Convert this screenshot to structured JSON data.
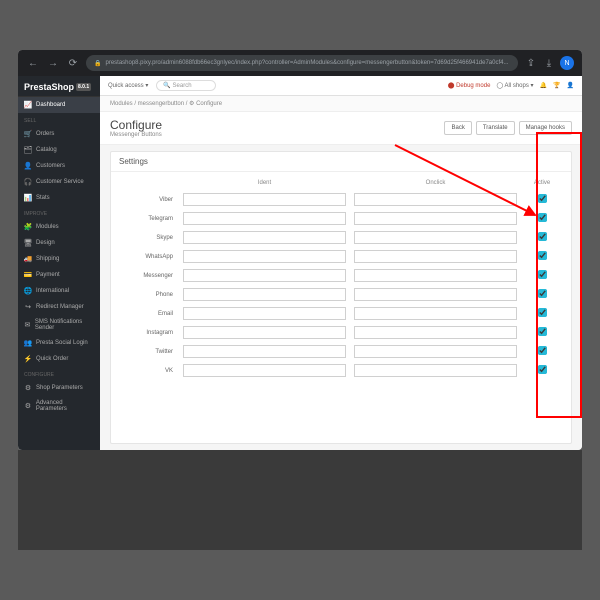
{
  "browser": {
    "url": "prestashop8.pixy.pro/admin6088fdb66ec3gnlyec/index.php?controller=AdminModules&configure=messengerbutton&token=7d69d25f466941de7a0cf4..."
  },
  "logo": {
    "text": "PrestaShop",
    "version": "8.0.1"
  },
  "topbar": {
    "quick": "Quick access",
    "search_ph": "Search",
    "debug": "Debug mode",
    "shops": "All shops"
  },
  "sidebar": {
    "dashboard": "Dashboard",
    "sect_sell": "SELL",
    "orders": "Orders",
    "catalog": "Catalog",
    "customers": "Customers",
    "customer_service": "Customer Service",
    "stats": "Stats",
    "sect_improve": "IMPROVE",
    "modules": "Modules",
    "design": "Design",
    "shipping": "Shipping",
    "payment": "Payment",
    "international": "International",
    "redirect": "Redirect Manager",
    "sms": "SMS Notifications Sender",
    "social": "Presta Social Login",
    "quickorder": "Quick Order",
    "sect_configure": "CONFIGURE",
    "shop_params": "Shop Parameters",
    "advanced": "Advanced Parameters"
  },
  "breadcrumb": "Modules / messengerbutton / ⚙ Configure",
  "page": {
    "title": "Configure",
    "subtitle": "Messenger Buttons"
  },
  "actions": {
    "back": "Back",
    "translate": "Translate",
    "hooks": "Manage hooks"
  },
  "panel": {
    "title": "Settings"
  },
  "cols": {
    "ident": "Ident",
    "onclick": "Onclick",
    "active": "Active"
  },
  "rows": [
    {
      "label": "Viber"
    },
    {
      "label": "Telegram"
    },
    {
      "label": "Skype"
    },
    {
      "label": "WhatsApp"
    },
    {
      "label": "Messenger"
    },
    {
      "label": "Phone"
    },
    {
      "label": "Email"
    },
    {
      "label": "Instagram"
    },
    {
      "label": "Twitter"
    },
    {
      "label": "VK"
    }
  ]
}
